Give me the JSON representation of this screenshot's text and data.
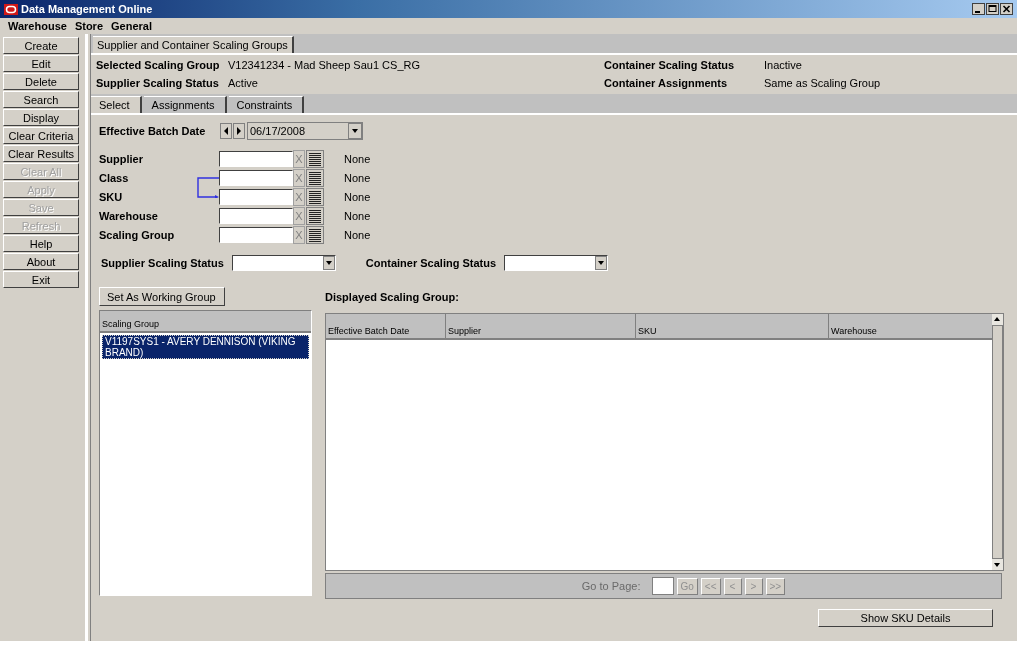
{
  "window": {
    "title": "Data Management Online"
  },
  "menu": [
    "Warehouse",
    "Store",
    "General"
  ],
  "sidebar": {
    "buttons": [
      {
        "label": "Create",
        "disabled": false
      },
      {
        "label": "Edit",
        "disabled": false
      },
      {
        "label": "Delete",
        "disabled": false
      },
      {
        "label": "Search",
        "disabled": false
      },
      {
        "label": "Display",
        "disabled": false
      },
      {
        "label": "Clear Criteria",
        "disabled": false
      },
      {
        "label": "Clear Results",
        "disabled": false
      },
      {
        "label": "Clear All",
        "disabled": true
      },
      {
        "label": "Apply",
        "disabled": true
      },
      {
        "label": "Save",
        "disabled": true
      },
      {
        "label": "Refresh",
        "disabled": true
      },
      {
        "label": "Help",
        "disabled": false
      },
      {
        "label": "About",
        "disabled": false
      },
      {
        "label": "Exit",
        "disabled": false
      }
    ]
  },
  "main_tabs": [
    {
      "label": "Supplier and Container Scaling Groups",
      "selected": true
    }
  ],
  "info": {
    "left": [
      {
        "label": "Selected Scaling Group",
        "value": "V12341234  - Mad Sheep Sau1 CS_RG"
      },
      {
        "label": "Supplier Scaling Status",
        "value": "Active"
      }
    ],
    "right": [
      {
        "label": "Container Scaling Status",
        "value": "Inactive"
      },
      {
        "label": "Container Assignments",
        "value": "Same as Scaling Group"
      }
    ]
  },
  "sub_tabs": [
    {
      "label": "Select",
      "selected": true
    },
    {
      "label": "Assignments",
      "selected": false
    },
    {
      "label": "Constraints",
      "selected": false
    }
  ],
  "batch_date": {
    "label": "Effective Batch Date",
    "value": "06/17/2008"
  },
  "criteria": [
    {
      "label": "Supplier",
      "clear": "X",
      "value": "None"
    },
    {
      "label": "Class",
      "clear": "X",
      "value": "None"
    },
    {
      "label": "SKU",
      "clear": "X",
      "value": "None"
    },
    {
      "label": "Warehouse",
      "clear": "X",
      "value": "None"
    },
    {
      "label": "Scaling Group",
      "clear": "X",
      "value": "None"
    }
  ],
  "status_filters": [
    {
      "label": "Supplier Scaling Status"
    },
    {
      "label": "Container Scaling Status"
    }
  ],
  "set_button": "Set As Working Group",
  "scaling_groups": {
    "heading": "Scaling Group",
    "items": [
      {
        "label": "V1197SYS1 - AVERY DENNISON (VIKING BRAND)",
        "selected": true
      }
    ]
  },
  "results": {
    "title": "Displayed Scaling Group:",
    "columns": [
      "Effective Batch Date",
      "Supplier",
      "SKU",
      "Warehouse"
    ]
  },
  "pager": {
    "label": "Go to Page:",
    "buttons": [
      "Go",
      "<<",
      "<",
      ">",
      ">>"
    ],
    "disabled": true
  },
  "show_sku_button": "Show SKU Details"
}
